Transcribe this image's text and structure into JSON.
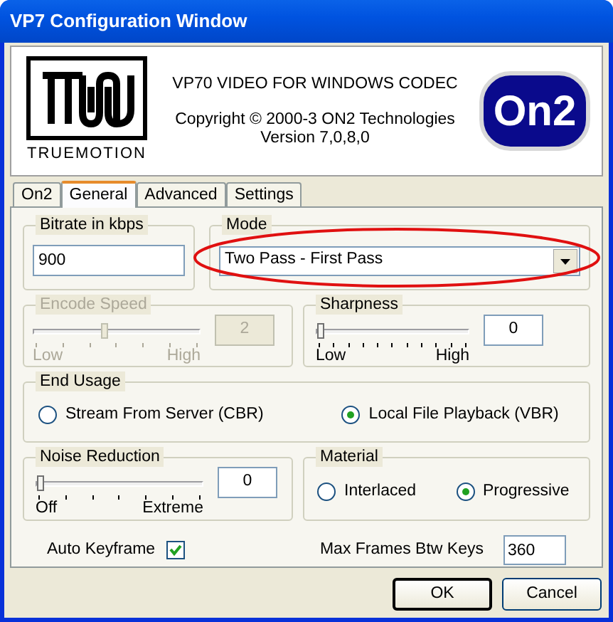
{
  "window": {
    "title": "VP7 Configuration Window"
  },
  "header": {
    "logo_left": "TRUEMOTION",
    "product": "VP70 VIDEO FOR WINDOWS CODEC",
    "copyright": "Copyright © 2000-3 ON2 Technologies",
    "version": "Version 7,0,8,0",
    "logo_right": "On2"
  },
  "tabs": [
    {
      "label": "On2",
      "selected": false
    },
    {
      "label": "General",
      "selected": true
    },
    {
      "label": "Advanced",
      "selected": false
    },
    {
      "label": "Settings",
      "selected": false
    }
  ],
  "bitrate": {
    "label": "Bitrate in kbps",
    "value": "900"
  },
  "mode": {
    "label": "Mode",
    "value": "Two Pass - First Pass",
    "highlighted": true
  },
  "encode_speed": {
    "label": "Encode Speed",
    "disabled": true,
    "level": 0.42,
    "low": "Low",
    "high": "High",
    "value": "2"
  },
  "sharpness": {
    "label": "Sharpness",
    "disabled": false,
    "level": 0,
    "low": "Low",
    "high": "High",
    "value": "0"
  },
  "end_usage": {
    "label": "End Usage",
    "options": [
      {
        "label": "Stream From Server (CBR)",
        "selected": false
      },
      {
        "label": "Local File Playback (VBR)",
        "selected": true
      }
    ]
  },
  "noise_reduction": {
    "label": "Noise Reduction",
    "disabled": false,
    "level": 0,
    "low": "Off",
    "high": "Extreme",
    "value": "0"
  },
  "material": {
    "label": "Material",
    "options": [
      {
        "label": "Interlaced",
        "selected": false
      },
      {
        "label": "Progressive",
        "selected": true
      }
    ]
  },
  "auto_keyframe": {
    "label": "Auto Keyframe",
    "checked": true
  },
  "max_frames": {
    "label": "Max Frames Btw Keys",
    "value": "360"
  },
  "buttons": [
    "OK",
    "Cancel"
  ]
}
